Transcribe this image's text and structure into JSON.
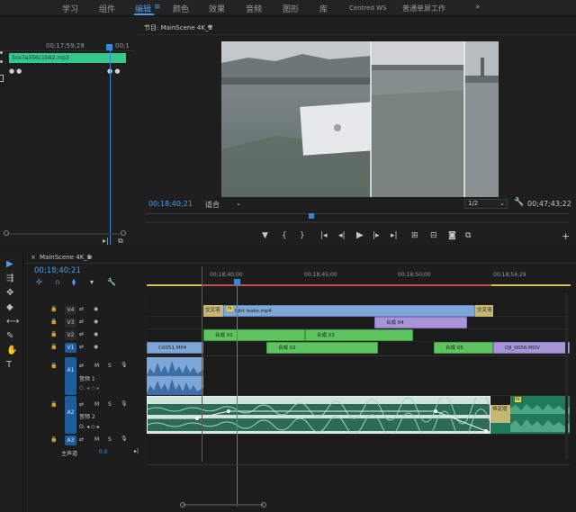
{
  "workspaces": [
    {
      "label": "学习",
      "active": false
    },
    {
      "label": "组件",
      "active": false
    },
    {
      "label": "编辑",
      "active": true
    },
    {
      "label": "颜色",
      "active": false
    },
    {
      "label": "效果",
      "active": false
    },
    {
      "label": "音频",
      "active": false
    },
    {
      "label": "图形",
      "active": false
    },
    {
      "label": "库",
      "active": false
    },
    {
      "label": "Centred WS",
      "active": false
    },
    {
      "label": "普通单屏工作",
      "active": false
    }
  ],
  "workspaces_more": "»",
  "source": {
    "timecode_left": "00;17;59;29",
    "timecode_right": "00;1",
    "clip_name": "5ce7a356c1b82.mp3"
  },
  "program": {
    "title": "节目: MainScene 4K_1",
    "menu_icon": "≡",
    "current_timecode": "00;18;40;21",
    "zoom_label": "适合",
    "resolution": "1/2",
    "duration_timecode": "00;47;43;22"
  },
  "timeline": {
    "sequence_tab": "MainScene 4K_1",
    "menu_icon": "≡",
    "current_timecode": "00;18;40;21",
    "ruler_labels": [
      "00;18;40;00",
      "00;18;45;00",
      "00;18;50;00",
      "00;18;54;29"
    ],
    "tracks": [
      {
        "name": "V4"
      },
      {
        "name": "V3"
      },
      {
        "name": "V2"
      },
      {
        "name": "V1"
      },
      {
        "name": "A1",
        "label": "音频 1"
      },
      {
        "name": "A2",
        "label": "音频 2"
      },
      {
        "name": "A3"
      }
    ],
    "master_label": "主声道",
    "master_value": "0.0",
    "clips": {
      "v4_trans_a": "交叉溶",
      "v4_main": "ight leaks.mp4",
      "v4_trans_b": "交叉溶",
      "v3_clip": "合成 04",
      "v2_clip1": "合成 01",
      "v2_clip2": "合成 03",
      "v1_clip0": "C0051.MP4",
      "v1_clip1": "合成 02",
      "v1_clip2": "合成 05",
      "v1_clip3": "DJI_0056.MOV",
      "a2_trans": "恒定增"
    },
    "audio_marker": "fx"
  },
  "colors": {
    "accent_blue": "#4a9cf0",
    "clip_green": "#5fc45f",
    "clip_blue": "#7ea7d8",
    "clip_purple": "#a795d8",
    "audio_teal": "#1f7a5c"
  }
}
